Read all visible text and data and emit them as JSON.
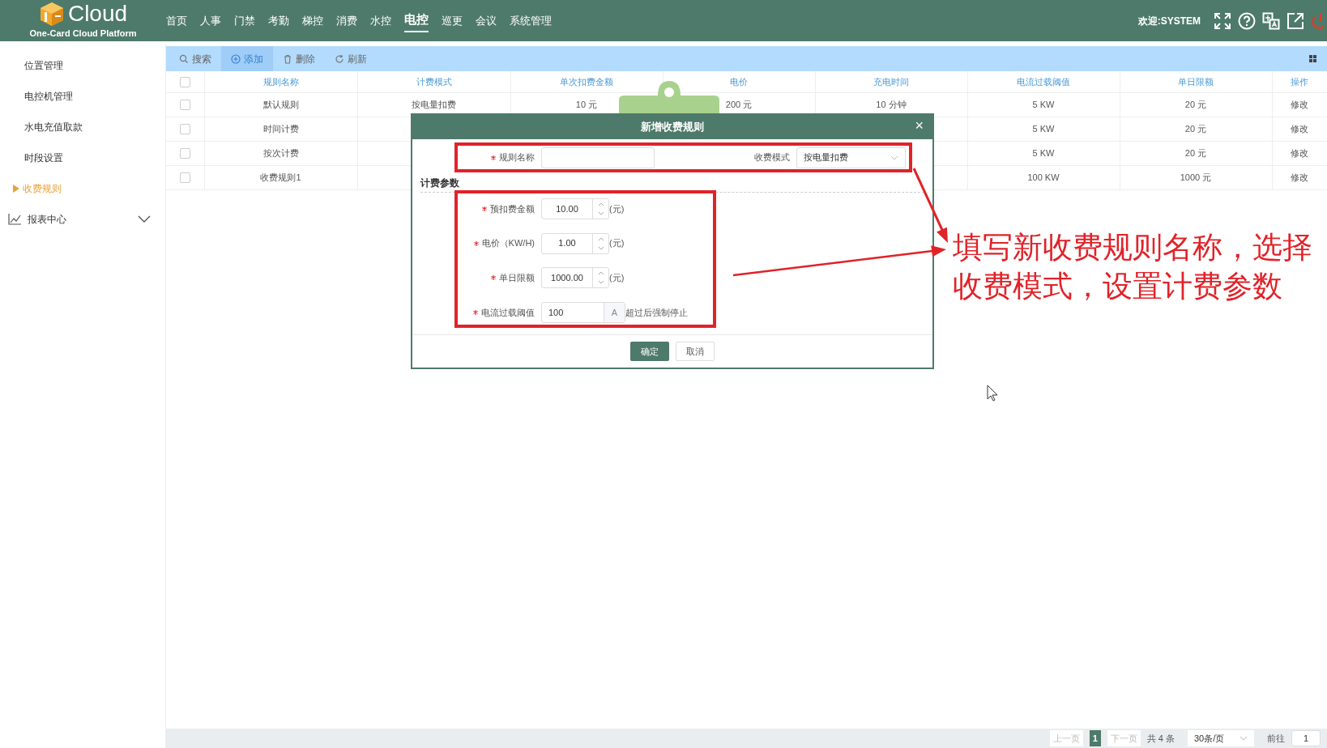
{
  "header": {
    "logo_text": "Cloud",
    "subtitle": "One-Card Cloud Platform",
    "welcome": "欢迎:SYSTEM",
    "nav": [
      {
        "label": "首页",
        "selected": false
      },
      {
        "label": "人事",
        "selected": false
      },
      {
        "label": "门禁",
        "selected": false
      },
      {
        "label": "考勤",
        "selected": false
      },
      {
        "label": "梯控",
        "selected": false
      },
      {
        "label": "消费",
        "selected": false
      },
      {
        "label": "水控",
        "selected": false
      },
      {
        "label": "电控",
        "selected": true
      },
      {
        "label": "巡更",
        "selected": false
      },
      {
        "label": "会议",
        "selected": false
      },
      {
        "label": "系统管理",
        "selected": false
      }
    ]
  },
  "sidebar": {
    "items": [
      {
        "label": "位置管理",
        "selected": false
      },
      {
        "label": "电控机管理",
        "selected": false
      },
      {
        "label": "水电充值取款",
        "selected": false
      },
      {
        "label": "时段设置",
        "selected": false
      },
      {
        "label": "收费规则",
        "selected": true
      }
    ],
    "groups": [
      {
        "label": "报表中心",
        "expanded": false
      }
    ]
  },
  "toolbar": {
    "buttons": [
      {
        "label": "搜索",
        "kind": "search",
        "selected": false
      },
      {
        "label": "添加",
        "kind": "add",
        "selected": true
      },
      {
        "label": "删除",
        "kind": "delete",
        "selected": false
      },
      {
        "label": "刷新",
        "kind": "refresh",
        "selected": false
      }
    ]
  },
  "table": {
    "all_checked": false,
    "columns": [
      "规则名称",
      "计费模式",
      "单次扣费金额",
      "电价",
      "充电时间",
      "电流过载阈值",
      "单日限额",
      "操作"
    ],
    "rows": [
      {
        "checked": false,
        "cells": [
          "默认规则",
          "按电量扣费",
          "10 元",
          "200 元",
          "10 分钟",
          "5 KW",
          "20 元",
          "修改"
        ]
      },
      {
        "checked": false,
        "cells": [
          "时间计费",
          null,
          null,
          null,
          null,
          "5 KW",
          "20 元",
          "修改"
        ]
      },
      {
        "checked": false,
        "cells": [
          "按次计费",
          null,
          null,
          null,
          null,
          "5 KW",
          "20 元",
          "修改"
        ]
      },
      {
        "checked": false,
        "cells": [
          "收费规则1",
          null,
          null,
          null,
          null,
          "100 KW",
          "1000 元",
          "修改"
        ]
      }
    ]
  },
  "dialog": {
    "title": "新增收费规则",
    "close": "×",
    "name_field": {
      "label": "规则名称",
      "required": true
    },
    "mode_field": {
      "label": "收费模式",
      "value": "按电量扣费",
      "required": false
    },
    "section": "计费参数",
    "params": [
      {
        "kind": "spinner",
        "label": "预扣费金额",
        "required": true,
        "value": "10.00",
        "unit": "(元)"
      },
      {
        "kind": "spinner",
        "label": "电价（KW/H)",
        "required": true,
        "value": "1.00",
        "unit": "(元)"
      },
      {
        "kind": "spinner",
        "label": "单日限额",
        "required": true,
        "value": "1000.00",
        "unit": "(元)"
      },
      {
        "kind": "suffix",
        "label": "电流过载阈值",
        "required": true,
        "value": "100",
        "suffix": "A",
        "unit": "超过后强制停止"
      }
    ],
    "buttons": [
      {
        "label": "确定",
        "primary": true
      },
      {
        "label": "取消",
        "primary": false
      }
    ]
  },
  "annotation": {
    "text": "填写新收费规则名称，选择收费模式，设置计费参数"
  },
  "pagination": {
    "prev": "上一页",
    "pages": [
      {
        "label": "1",
        "selected": true
      }
    ],
    "next": "下一页",
    "total": "共 4 条",
    "page_size": "30条/页",
    "goto_label": "前往",
    "goto_value": "1"
  }
}
